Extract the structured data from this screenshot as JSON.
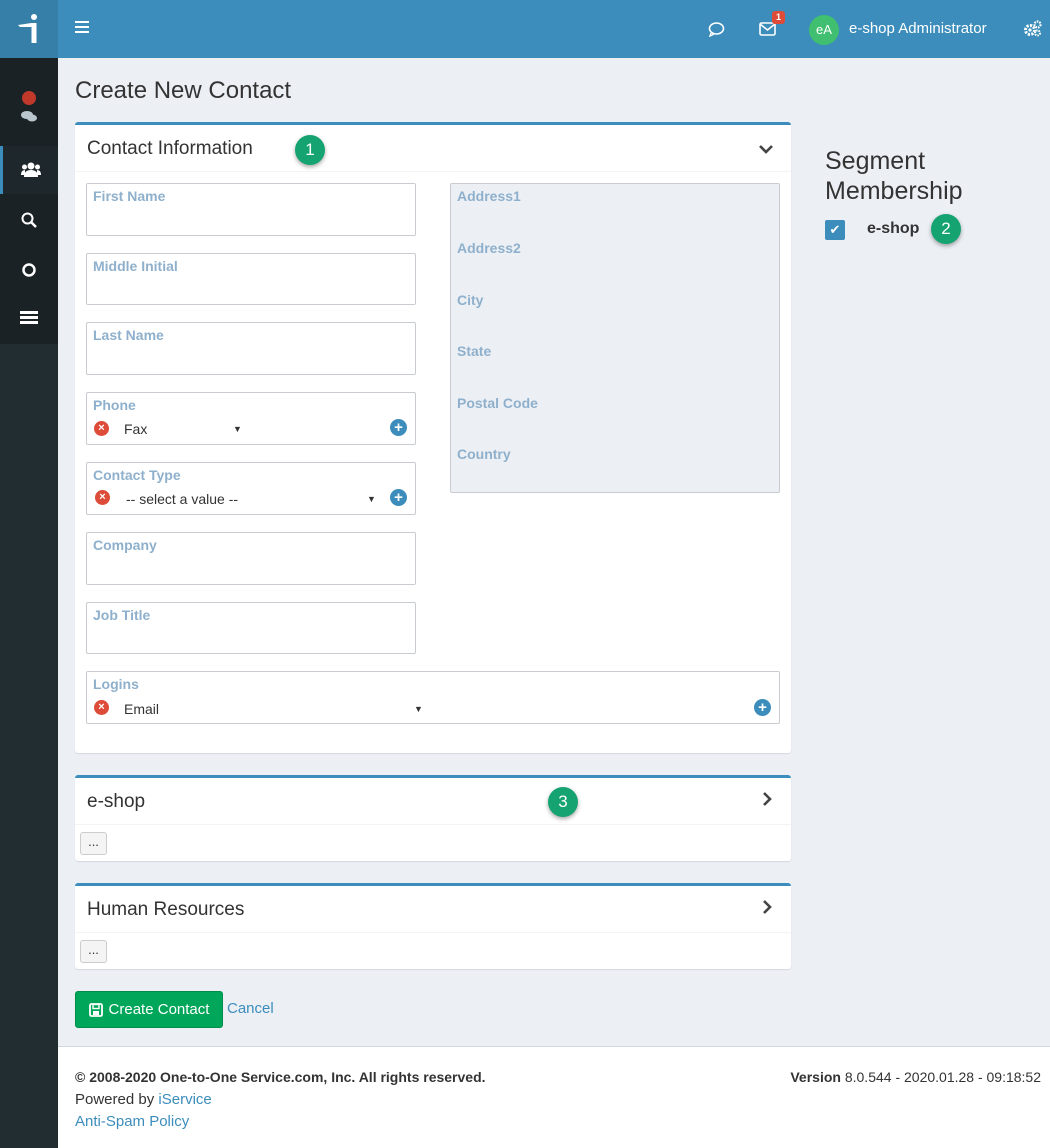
{
  "header": {
    "user_initials": "eA",
    "user_name": "e-shop Administrator",
    "notification_count": "1"
  },
  "page": {
    "title": "Create New Contact"
  },
  "contact_info": {
    "title": "Contact Information",
    "step": "1",
    "fields": {
      "first_name": "First Name",
      "middle_initial": "Middle Initial",
      "last_name": "Last Name",
      "phone": "Phone",
      "phone_type": "Fax",
      "contact_type": "Contact Type",
      "contact_type_value": "-- select a value --",
      "company": "Company",
      "job_title": "Job Title",
      "logins": "Logins",
      "login_type": "Email"
    },
    "address": {
      "address1": "Address1",
      "address2": "Address2",
      "city": "City",
      "state": "State",
      "postal_code": "Postal Code",
      "country": "Country"
    }
  },
  "segment": {
    "title": "Segment Membership",
    "item": "e-shop",
    "checked": true,
    "step": "2"
  },
  "eshop_section": {
    "title": "e-shop",
    "step": "3",
    "more": "..."
  },
  "hr_section": {
    "title": "Human Resources",
    "more": "..."
  },
  "actions": {
    "create": "Create Contact",
    "cancel": "Cancel"
  },
  "footer": {
    "copyright": "© 2008-2020 One-to-One Service.com, Inc. All rights reserved.",
    "powered_prefix": "Powered by ",
    "powered_link": "iService",
    "antispam": "Anti-Spam Policy",
    "version_label": "Version",
    "version_value": " 8.0.544 - 2020.01.28 - 09:18:52"
  },
  "colors": {
    "header": "#3c8dbc",
    "sidebar": "#222d32",
    "success": "#00a65a",
    "step_badge": "#16a372",
    "remove": "#dd4b39"
  }
}
